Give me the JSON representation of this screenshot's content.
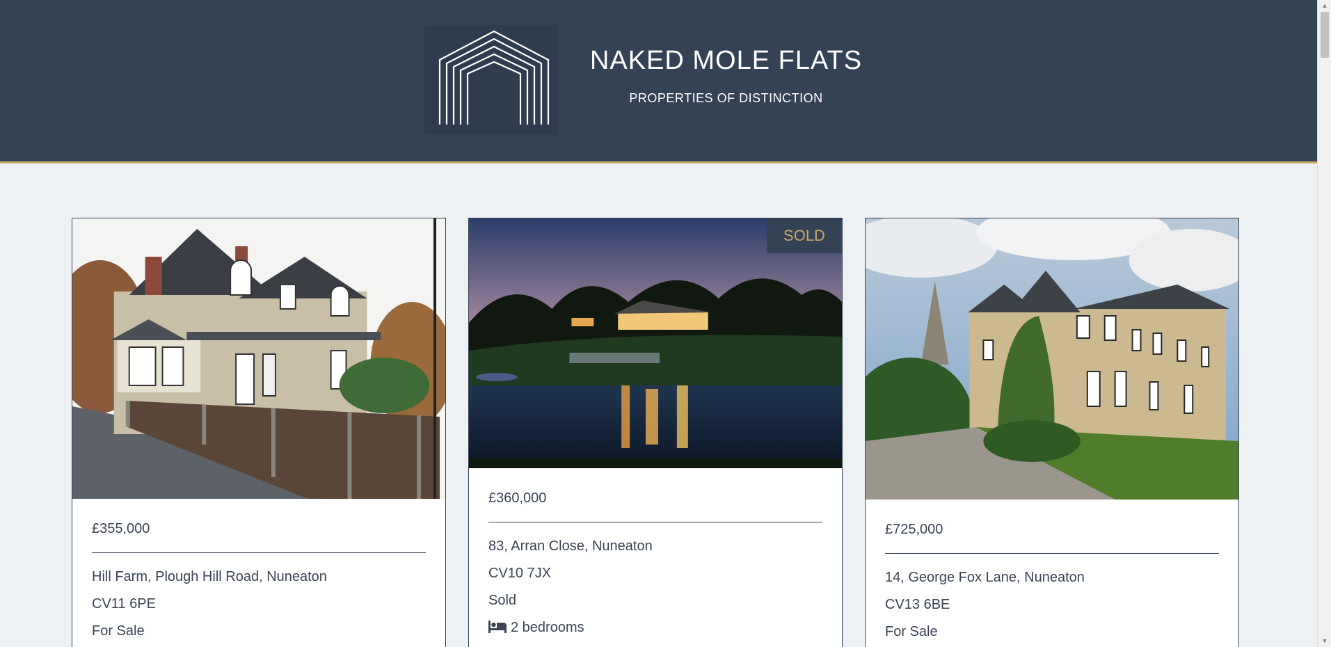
{
  "header": {
    "title": "NAKED MOLE FLATS",
    "subtitle": "PROPERTIES OF DISTINCTION",
    "logo_icon": "nested-arch-logo-icon"
  },
  "colors": {
    "header_bg": "#344256",
    "accent": "#c9a96a",
    "page_bg": "#eef1f3",
    "text": "#3a4454"
  },
  "properties": [
    {
      "price": "£355,000",
      "address": "Hill Farm, Plough Hill Road, Nuneaton",
      "postcode": "CV11 6PE",
      "status": "For Sale"
    },
    {
      "price": "£360,000",
      "address": "83, Arran Close, Nuneaton",
      "postcode": "CV10 7JX",
      "status": "Sold",
      "badge": "SOLD",
      "bedrooms": "2 bedrooms",
      "bedroom_icon": "bed-icon"
    },
    {
      "price": "£725,000",
      "address": "14, George Fox Lane, Nuneaton",
      "postcode": "CV13 6BE",
      "status": "For Sale"
    }
  ]
}
